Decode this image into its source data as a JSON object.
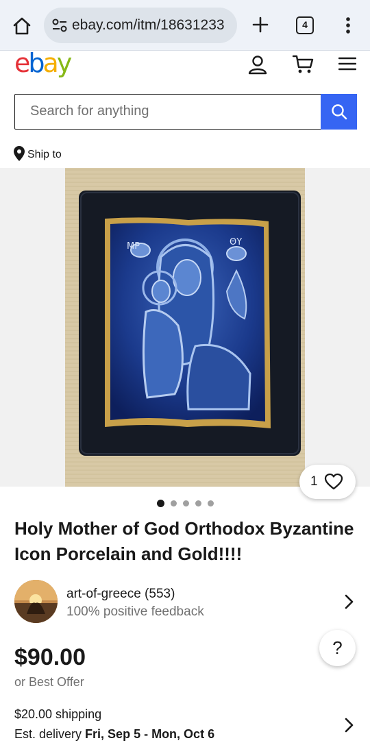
{
  "browser": {
    "url": "ebay.com/itm/18631233",
    "tab_count": "4"
  },
  "header": {
    "logo": {
      "e": "e",
      "b": "b",
      "a": "a",
      "y": "y"
    },
    "logo_colors": {
      "e": "#e53238",
      "b": "#0064d2",
      "a": "#f5af02",
      "y": "#86b817"
    }
  },
  "search": {
    "placeholder": "Search for anything",
    "value": "",
    "button_color": "#3665f3"
  },
  "ship_to": {
    "label": "Ship to"
  },
  "gallery": {
    "watch_count": "1",
    "image_count": 5,
    "active_index": 0,
    "icon_text_left": "ΜΡ",
    "icon_text_right": "ΘΥ"
  },
  "listing": {
    "title": "Holy Mother of God Orthodox Byzantine Icon Porcelain and Gold!!!!",
    "price": "$90.00",
    "best_offer": "or Best Offer",
    "shipping": "$20.00 shipping",
    "delivery_prefix": "Est. delivery ",
    "delivery_dates": "Fri, Sep 5 - Mon, Oct 6"
  },
  "seller": {
    "name": "art-of-greece (553)",
    "feedback": "100% positive feedback"
  },
  "help": {
    "label": "?"
  },
  "icons": [
    "home-icon",
    "site-settings-icon",
    "plus-icon",
    "tabs-icon",
    "more-vert-icon",
    "user-icon",
    "cart-icon",
    "menu-icon",
    "search-icon",
    "location-pin-icon",
    "heart-icon",
    "chevron-right-icon"
  ]
}
